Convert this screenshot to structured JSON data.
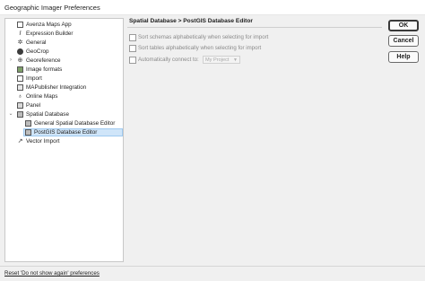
{
  "window": {
    "title": "Geographic Imager Preferences"
  },
  "tree": {
    "items": [
      {
        "label": "Avenza Maps App",
        "icon": "avenza-maps-icon"
      },
      {
        "label": "Expression Builder",
        "icon": "expression-builder-icon"
      },
      {
        "label": "General",
        "icon": "gear-icon"
      },
      {
        "label": "GeoCrop",
        "icon": "geocrop-icon"
      },
      {
        "label": "Georeference",
        "icon": "georeference-icon"
      },
      {
        "label": "Image formats",
        "icon": "image-formats-icon"
      },
      {
        "label": "Import",
        "icon": "import-icon"
      },
      {
        "label": "MAPublisher Integration",
        "icon": "mapublisher-icon"
      },
      {
        "label": "Online Maps",
        "icon": "map-pin-icon"
      },
      {
        "label": "Panel",
        "icon": "panel-icon"
      },
      {
        "label": "Spatial Database",
        "icon": "database-icon"
      },
      {
        "label": "General Spatial Database Editor",
        "icon": "database-editor-icon"
      },
      {
        "label": "PostGIS Database Editor",
        "icon": "postgis-icon"
      },
      {
        "label": "Vector Import",
        "icon": "vector-import-icon"
      }
    ],
    "selected": "PostGIS Database Editor"
  },
  "content": {
    "title": "Spatial Database > PostGIS Database Editor",
    "options": [
      {
        "label": "Sort schemas alphabetically when selecting for import",
        "checked": false
      },
      {
        "label": "Sort tables alphabetically when selecting for import",
        "checked": false
      },
      {
        "label": "Automatically connect to:",
        "checked": false
      }
    ],
    "connect_select": {
      "value": "My Project"
    }
  },
  "buttons": {
    "ok": "OK",
    "cancel": "Cancel",
    "help": "Help"
  },
  "footer": {
    "reset_link": "Reset 'Do not show again' preferences"
  },
  "colors": {
    "selection": "#cfe5f9",
    "dialog_bg": "#f0f0f0"
  }
}
